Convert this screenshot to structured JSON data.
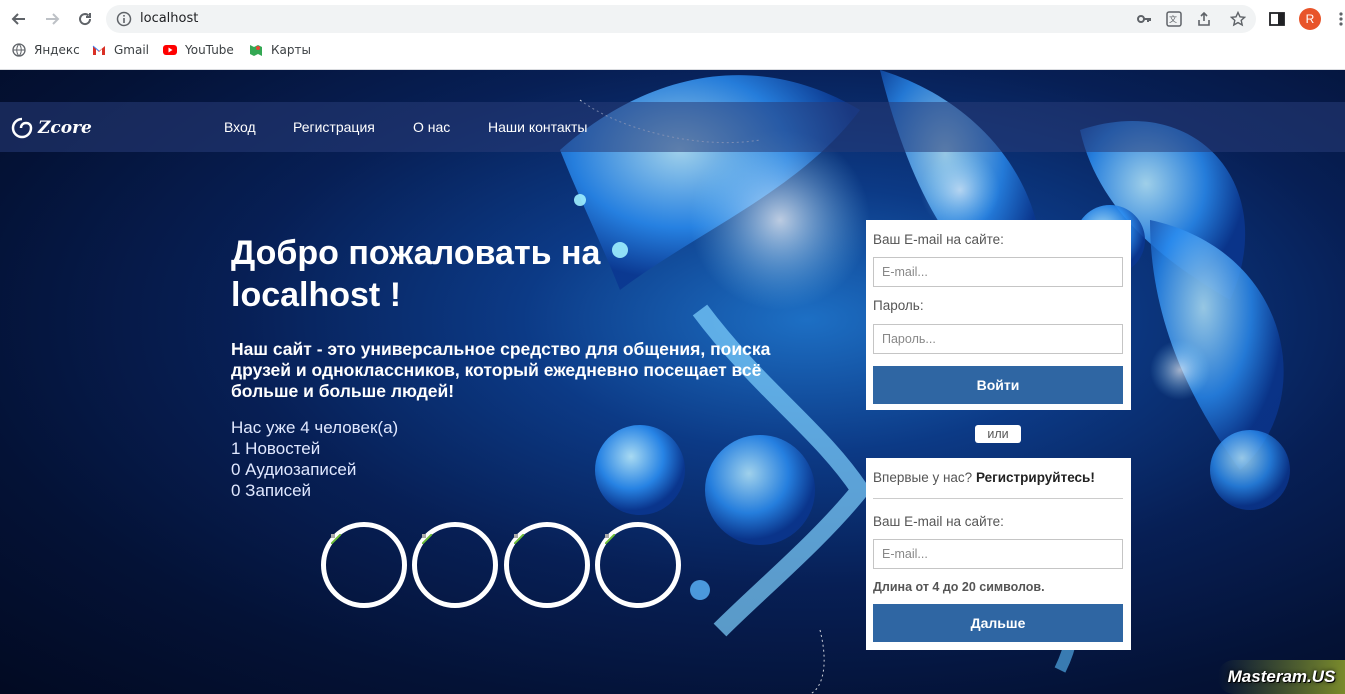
{
  "browser": {
    "url": "localhost",
    "avatar_letter": "R",
    "bookmarks": [
      {
        "label": "Яндекс",
        "icon": "globe-icon"
      },
      {
        "label": "Gmail",
        "icon": "gmail-icon"
      },
      {
        "label": "YouTube",
        "icon": "youtube-icon"
      },
      {
        "label": "Карты",
        "icon": "maps-icon"
      }
    ]
  },
  "site": {
    "logo": "Zcore",
    "menu": [
      "Вход",
      "Регистрация",
      "О нас",
      "Наши контакты"
    ],
    "hero_title": "Добро пожаловать на localhost !",
    "hero_desc": "Наш сайт - это универсальное средство для общения, поиска друзей и одноклассников, который ежедневно посещает всё больше и больше людей!",
    "stats": [
      "Нас уже 4 человек(а)",
      "1 Новостей",
      "0 Аудиозаписей",
      "0 Записей"
    ],
    "login": {
      "email_label": "Ваш E-mail на сайте:",
      "email_placeholder": "E-mail...",
      "password_label": "Пароль:",
      "password_placeholder": "Пароль...",
      "submit": "Войти"
    },
    "or_label": "или",
    "register": {
      "heading_prefix": "Впервые у нас?",
      "heading_strong": "Регистрируйтесь!",
      "email_label": "Ваш E-mail на сайте:",
      "email_placeholder": "E-mail...",
      "hint": "Длина от 4 до 20 символов.",
      "submit": "Дальше"
    },
    "watermark": "Masteram.US"
  },
  "colors": {
    "button": "#2f66a3",
    "navbar": "#283c78"
  }
}
